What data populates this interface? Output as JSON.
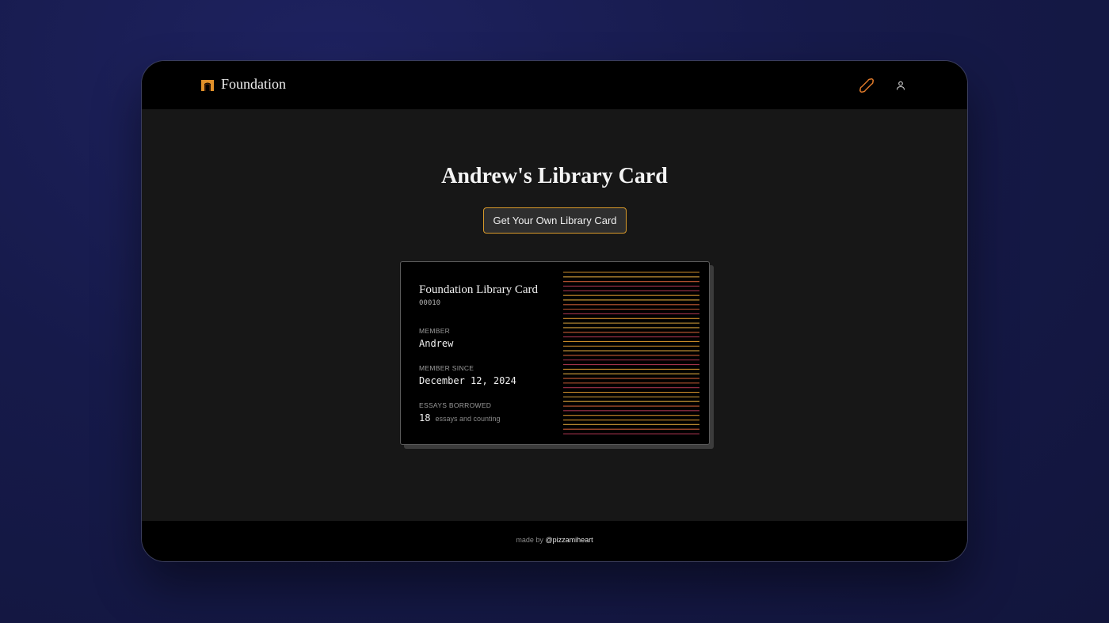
{
  "brand": {
    "name": "Foundation",
    "logo_icon": "arch-gate-icon",
    "logo_color": "#e0902a"
  },
  "nav": {
    "bone_icon": "bone-icon",
    "bone_color": "#e07a2a",
    "user_icon": "user-icon"
  },
  "page": {
    "title": "Andrew's Library Card",
    "cta_label": "Get Your Own Library Card",
    "cta_border_color": "#d99a2b"
  },
  "card": {
    "title": "Foundation Library Card",
    "number": "00010",
    "member_label": "MEMBER",
    "member_value": "Andrew",
    "since_label": "MEMBER SINCE",
    "since_value": "December 12, 2024",
    "borrowed_label": "ESSAYS BORROWED",
    "borrowed_count": "18",
    "borrowed_note": "essays and counting",
    "stripe_colors": [
      "#c98a2a",
      "#a0324a",
      "#c45a34",
      "#d6a03a"
    ]
  },
  "footer": {
    "prefix": "made by",
    "handle": "@pizzamiheart"
  }
}
